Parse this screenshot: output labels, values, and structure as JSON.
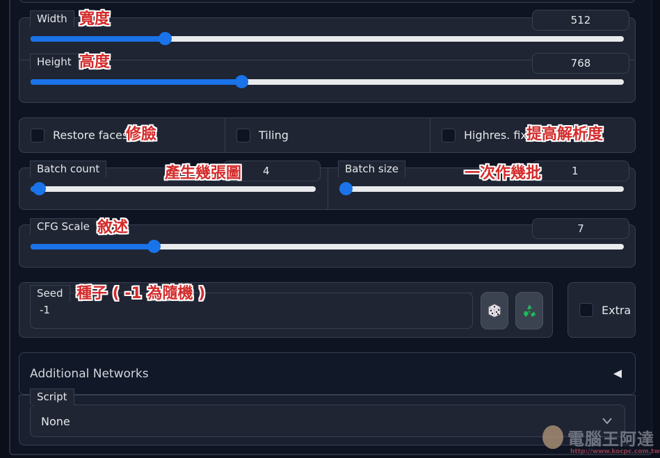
{
  "sliders": {
    "width": {
      "label": "Width",
      "value": "512",
      "fraction": 0.226,
      "annotation": "寬度"
    },
    "height": {
      "label": "Height",
      "value": "768",
      "fraction": 0.355,
      "annotation": "高度"
    },
    "batch_count": {
      "label": "Batch count",
      "value": "4",
      "fraction": 0.03,
      "annotation": "產生幾張圖"
    },
    "batch_size": {
      "label": "Batch size",
      "value": "1",
      "fraction": 0.0,
      "annotation": "一次作幾批"
    },
    "cfg_scale": {
      "label": "CFG Scale",
      "value": "7",
      "fraction": 0.207,
      "annotation": "敘述"
    }
  },
  "checkboxes": {
    "restore_faces": {
      "label": "Restore faces",
      "checked": false,
      "annotation": "修臉"
    },
    "tiling": {
      "label": "Tiling",
      "checked": false
    },
    "highres_fix": {
      "label": "Highres. fix",
      "checked": false,
      "annotation": "提高解析度"
    },
    "extra": {
      "label": "Extra",
      "checked": false
    }
  },
  "seed": {
    "label": "Seed",
    "value": "-1",
    "annotation": "種子 ( -1 為隨機 )",
    "random_button_icon": "dice-icon",
    "reuse_button_icon": "recycle-icon"
  },
  "additional_networks": {
    "label": "Additional Networks",
    "icon": "triangle-left-icon"
  },
  "script": {
    "label": "Script",
    "value": "None",
    "icon": "chevron-down-icon"
  },
  "colors": {
    "accent": "#1a73e8",
    "background": "#0b0f19",
    "panel": "#1f2533",
    "border": "#374151",
    "annotation": "#d42a2a"
  },
  "watermark": {
    "text": "電腦王阿達",
    "url_text": "http://www.kocpc.com.tw"
  }
}
